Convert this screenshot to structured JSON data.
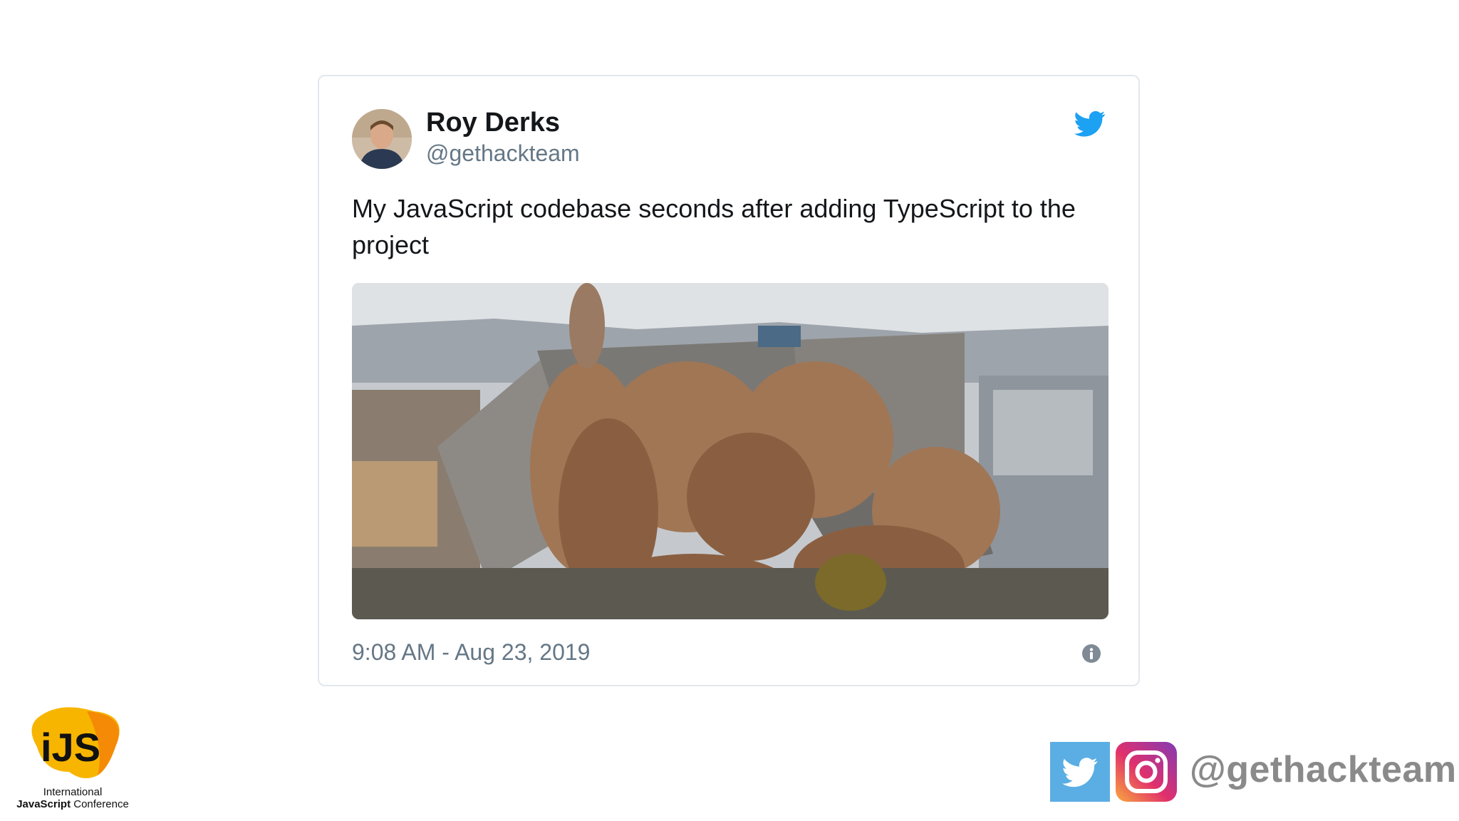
{
  "tweet": {
    "author_name": "Roy Derks",
    "author_handle": "@gethackteam",
    "text": "My JavaScript codebase seconds after adding TypeScript to the project",
    "timestamp": "9:08 AM - Aug 23, 2019",
    "icons": {
      "brand": "twitter-bird-icon",
      "info": "info-icon"
    }
  },
  "footer": {
    "conference_logo_text": "iJS",
    "conference_line1": "International",
    "conference_line2_bold": "JavaScript",
    "conference_line2_rest": " Conference",
    "social_handle": "@gethackteam",
    "social_icons": [
      "twitter-icon",
      "instagram-icon"
    ]
  },
  "colors": {
    "twitter_blue": "#1da1f2",
    "handle_gray": "#657786",
    "text_dark": "#14171a",
    "footer_twitter_bg": "#5aaee3",
    "ijs_yellow": "#f7b500"
  }
}
